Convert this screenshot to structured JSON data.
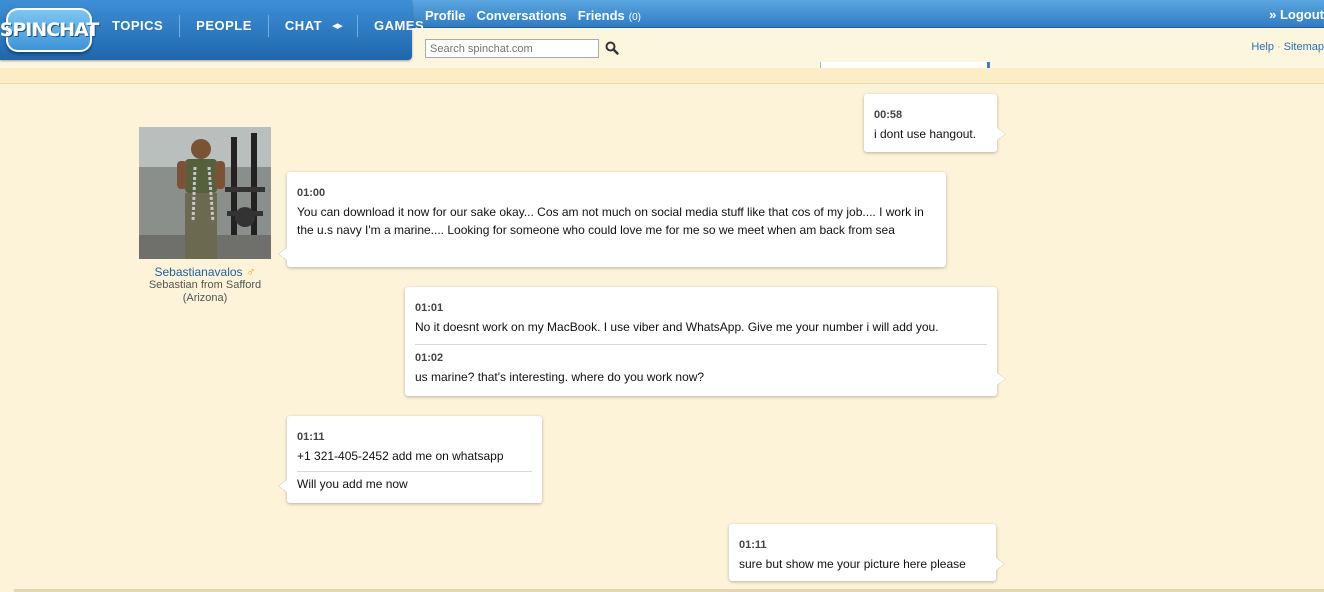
{
  "logo": {
    "text": "SPINCHAT"
  },
  "mainnav": [
    "TOPICS",
    "PEOPLE",
    "CHAT",
    "GAMES"
  ],
  "subnav": {
    "profile": "Profile",
    "conversations": "Conversations",
    "friends": "Friends",
    "friends_count": "(0)"
  },
  "logout": "» Logout",
  "search": {
    "placeholder": "Search spinchat.com",
    "icon": "search-icon"
  },
  "help": {
    "help": "Help",
    "sep": "·",
    "sitemap": "Sitemap"
  },
  "profile": {
    "username": "Sebastianavalos",
    "gender_icon": "male-icon",
    "gender_symbol": "♂",
    "line1": "Sebastian from Safford",
    "line2": "(Arizona)",
    "photo_alt": "profile-photo"
  },
  "messages": [
    {
      "time": "00:58",
      "text": "i dont use hangout.",
      "side": "right"
    },
    {
      "time": "01:00",
      "text": "You can download it now for our sake okay... Cos am not much on social media stuff like that cos of my job.... I work in the u.s navy I'm a marine.... Looking for someone who could love me for me so we meet when am back from sea",
      "side": "left"
    },
    {
      "time": "01:01",
      "text": "No it doesnt work on my MacBook. I use viber and WhatsApp. Give me your number i will add you.",
      "time2": "01:02",
      "text2": "us marine? that's interesting. where do you work now?",
      "side": "right"
    },
    {
      "time": "01:11",
      "text": "+1 321-405-2452 add me on whatsapp",
      "text2": "Will you add me now",
      "side": "left"
    },
    {
      "time": "01:11",
      "text": "sure but show me your picture here please",
      "side": "right"
    }
  ],
  "colors": {
    "nav_blue": "#2f7cc4",
    "background": "#fcf3d9",
    "link": "#2261a4",
    "male": "#e8a020"
  }
}
